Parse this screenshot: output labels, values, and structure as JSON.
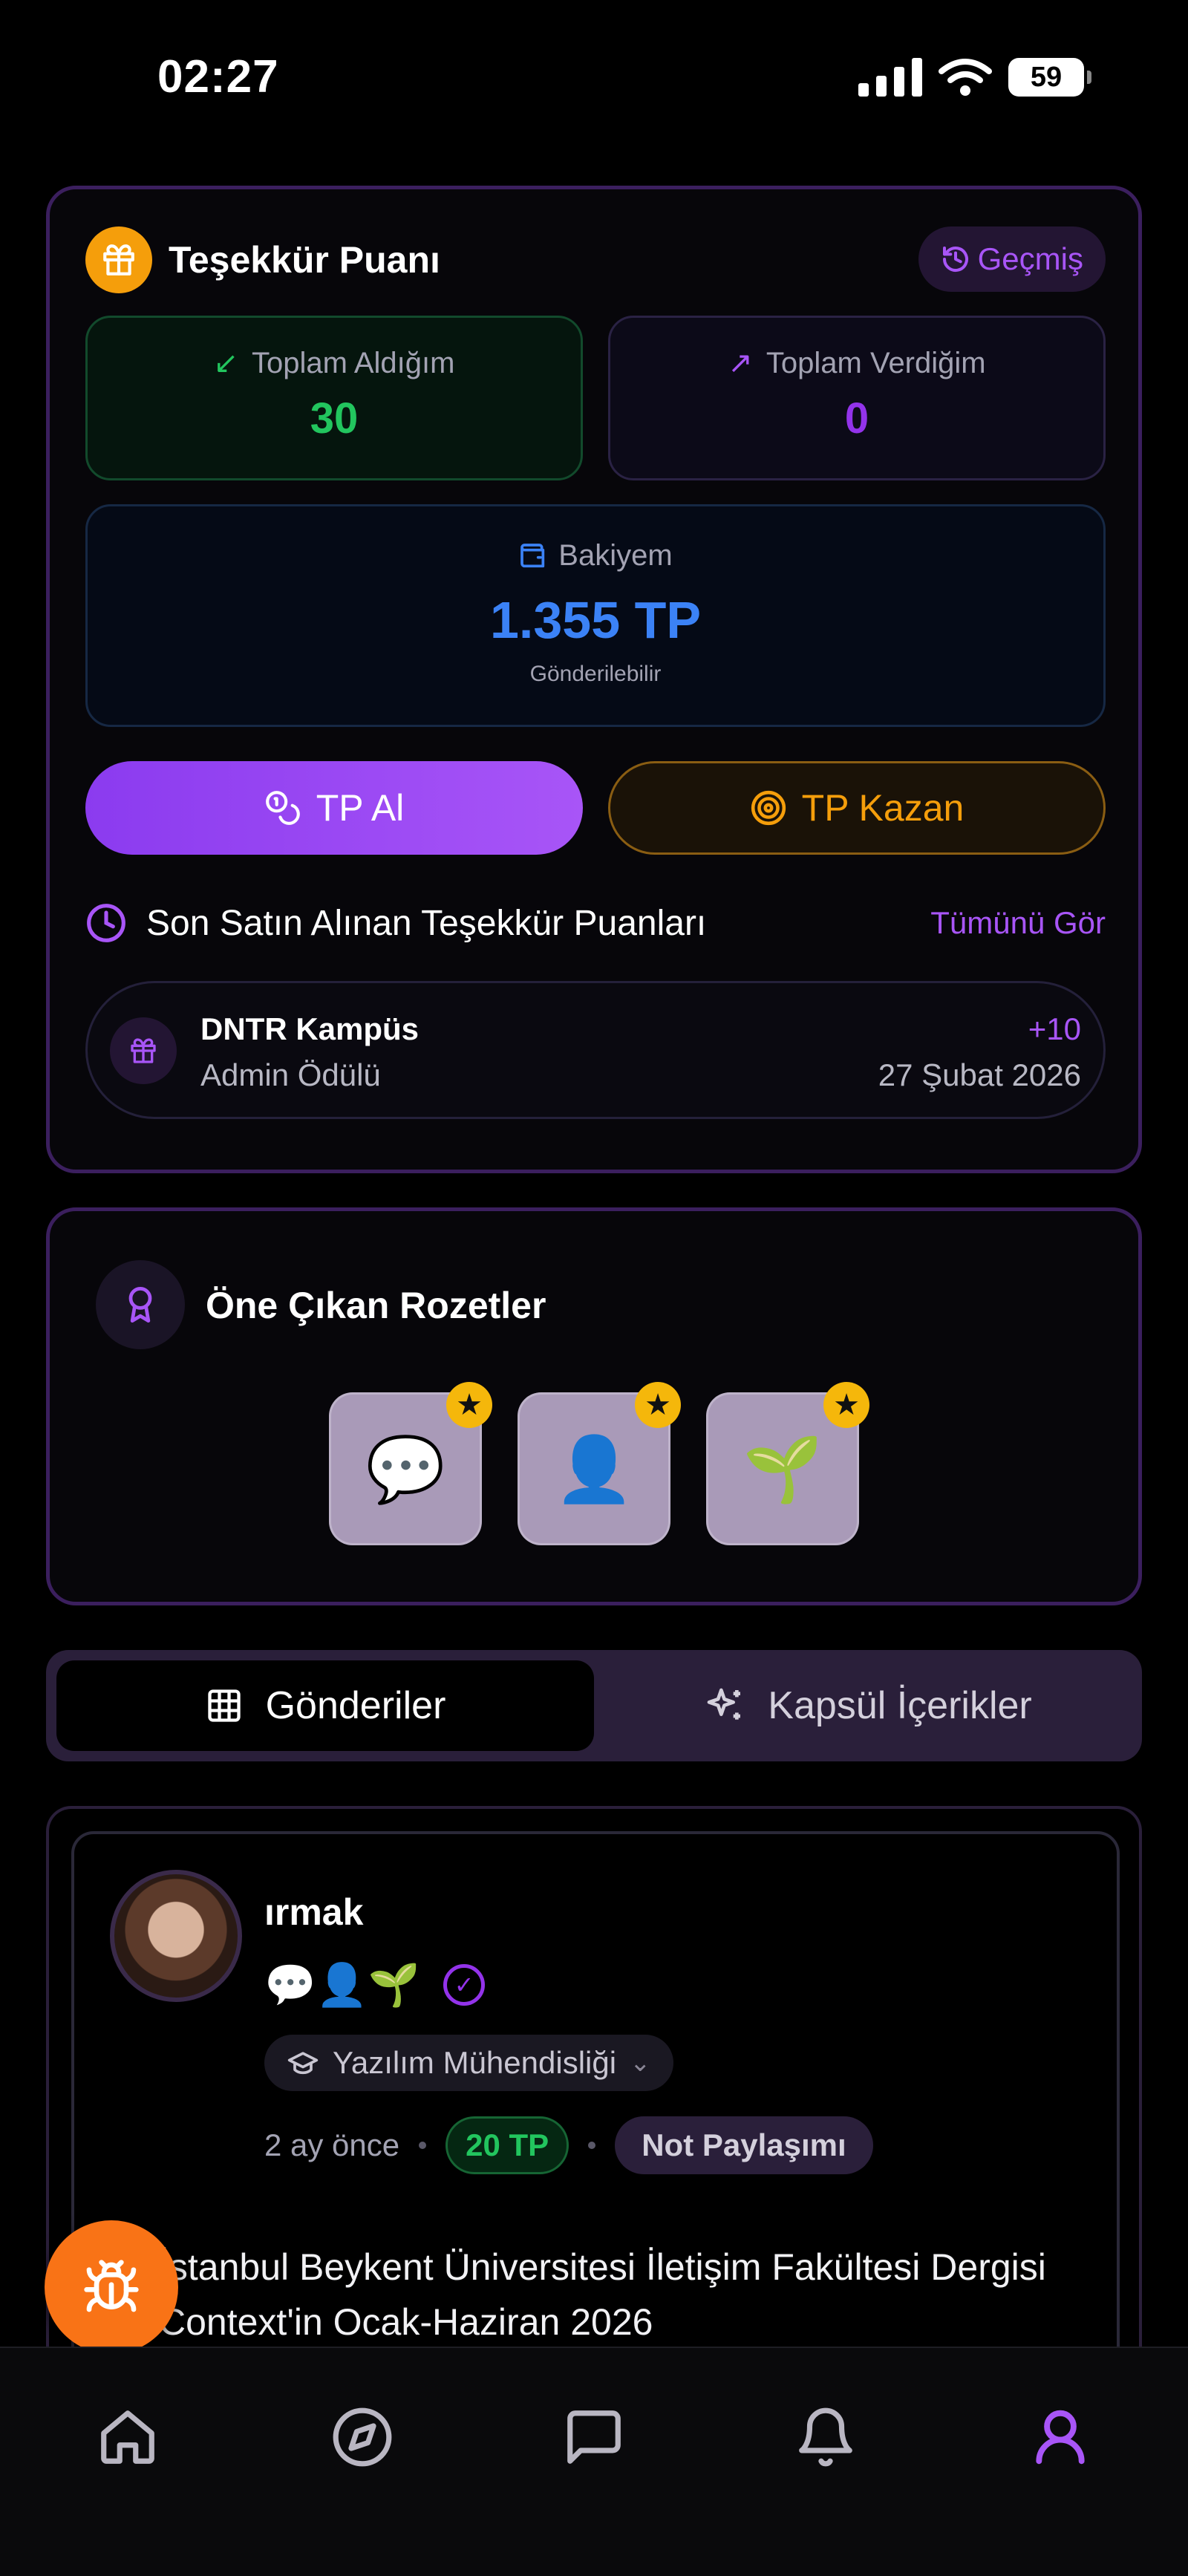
{
  "status_bar": {
    "time": "02:27",
    "battery": "59"
  },
  "thanks_card": {
    "title": "Teşekkür Puanı",
    "history_label": "Geçmiş",
    "received_label": "Toplam Aldığım",
    "received_value": "30",
    "given_label": "Toplam Verdiğim",
    "given_value": "0",
    "balance_label": "Bakiyem",
    "balance_value": "1.355 TP",
    "balance_sub": "Gönderilebilir",
    "buy_label": "TP Al",
    "earn_label": "TP Kazan",
    "recent_title": "Son Satın Alınan Teşekkür Puanları",
    "see_all_label": "Tümünü Gör",
    "recent": [
      {
        "name": "DNTR Kampüs",
        "desc": "Admin Ödülü",
        "amount": "+10",
        "date": "27 Şubat 2026"
      }
    ]
  },
  "badges_card": {
    "title": "Öne Çıkan Rozetler",
    "badges": [
      {
        "emoji": "💬",
        "icon": "speech-bubble-icon"
      },
      {
        "emoji": "👤",
        "icon": "user-silhouette-icon"
      },
      {
        "emoji": "🌱",
        "icon": "seedling-icon"
      }
    ]
  },
  "tabs": [
    {
      "label": "Gönderiler",
      "icon": "grid-icon",
      "active": true
    },
    {
      "label": "Kapsül İçerikler",
      "icon": "sparkles-icon",
      "active": false
    }
  ],
  "post": {
    "username": "ırmak",
    "emojis": "💬👤🌱",
    "department": "Yazılım Mühendisliği",
    "time_ago": "2 ay önce",
    "tp": "20 TP",
    "type": "Not Paylaşımı",
    "text": "İstanbul Beykent Üniversitesi İletişim Fakültesi Dergisi Context'in Ocak-Haziran 2026"
  },
  "nav": [
    {
      "icon": "home-icon",
      "active": false
    },
    {
      "icon": "compass-icon",
      "active": false
    },
    {
      "icon": "message-icon",
      "active": false
    },
    {
      "icon": "bell-icon",
      "active": false
    },
    {
      "icon": "user-icon",
      "active": true
    }
  ],
  "colors": {
    "accent_purple": "#a855f7",
    "green": "#22c55e",
    "blue": "#3b82f6",
    "amber": "#f59e0b",
    "bug_orange": "#f97316"
  }
}
